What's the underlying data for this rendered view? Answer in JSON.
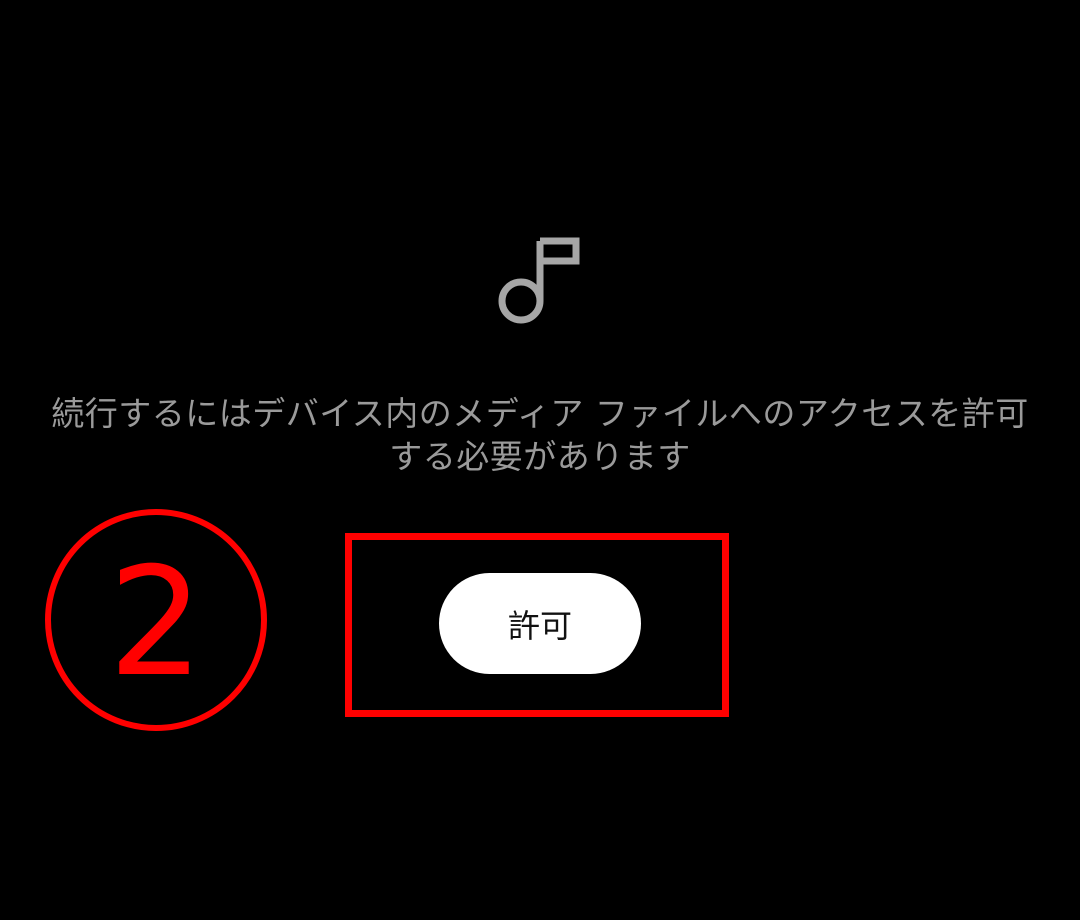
{
  "icon": {
    "name": "music-note-icon",
    "color": "#a6a6a6"
  },
  "message": {
    "line1": "続行するにはデバイス内のメディア ファイルへのアクセスを許可",
    "line2": "する必要があります"
  },
  "allow_button": {
    "label": "許可"
  },
  "annotation": {
    "step_number": "2",
    "color": "#ff0000"
  }
}
